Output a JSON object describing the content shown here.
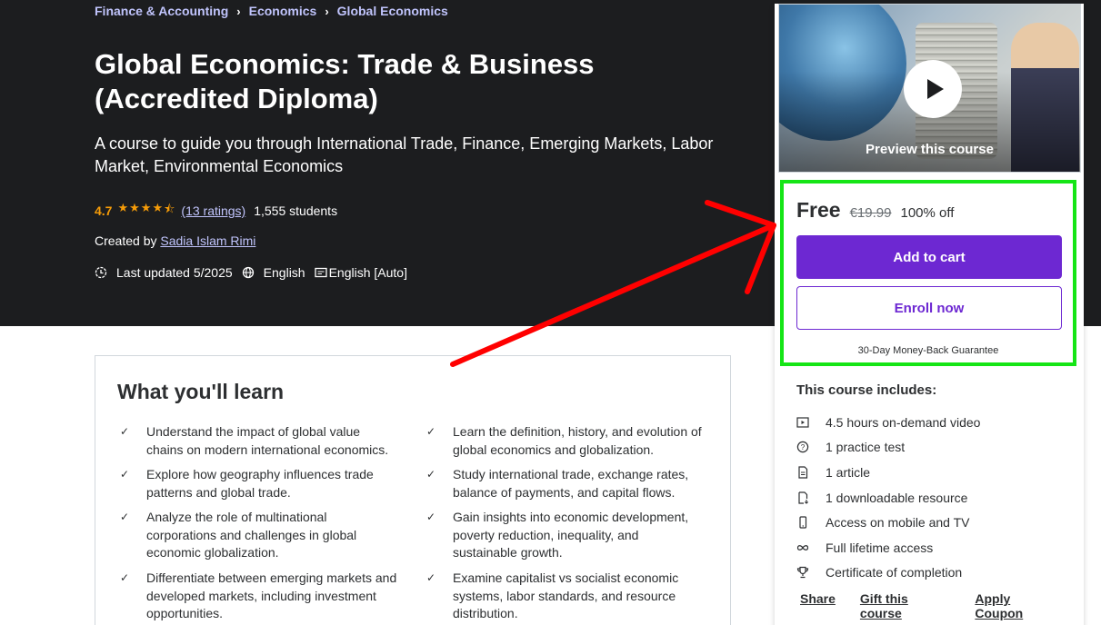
{
  "breadcrumb": [
    "Finance & Accounting",
    "Economics",
    "Global Economics"
  ],
  "course": {
    "title": "Global Economics: Trade & Business (Accredited Diploma)",
    "subtitle": "A course to guide you through International Trade, Finance, Emerging Markets, Labor Market, Environmental Economics",
    "rating": "4.7",
    "rating_stars": 4.7,
    "ratings_count": "(13 ratings)",
    "students": "1,555 students",
    "created_by_label": "Created by",
    "author": "Sadia Islam Rimi",
    "last_updated": "Last updated 5/2025",
    "language": "English",
    "captions": "English [Auto]"
  },
  "learn": {
    "heading": "What you'll learn",
    "left": [
      "Understand the impact of global value chains on modern international economics.",
      "Explore how geography influences trade patterns and global trade.",
      "Analyze the role of multinational corporations and challenges in global economic globalization.",
      "Differentiate between emerging markets and developed markets, including investment opportunities."
    ],
    "right": [
      "Learn the definition, history, and evolution of global economics and globalization.",
      "Study international trade, exchange rates, balance of payments, and capital flows.",
      "Gain insights into economic development, poverty reduction, inequality, and sustainable growth.",
      "Examine capitalist vs socialist economic systems, labor standards, and resource distribution."
    ]
  },
  "sidebar": {
    "preview_label": "Preview this course",
    "price": "Free",
    "original_price": "€19.99",
    "discount": "100% off",
    "add_to_cart": "Add to cart",
    "enroll_now": "Enroll now",
    "guarantee": "30-Day Money-Back Guarantee",
    "includes_title": "This course includes:",
    "includes": [
      {
        "icon": "video-icon",
        "label": "4.5 hours on-demand video"
      },
      {
        "icon": "question-icon",
        "label": "1 practice test"
      },
      {
        "icon": "article-icon",
        "label": "1 article"
      },
      {
        "icon": "download-file-icon",
        "label": "1 downloadable resource"
      },
      {
        "icon": "mobile-icon",
        "label": "Access on mobile and TV"
      },
      {
        "icon": "infinity-icon",
        "label": "Full lifetime access"
      },
      {
        "icon": "trophy-icon",
        "label": "Certificate of completion"
      }
    ],
    "links": [
      "Share",
      "Gift this course",
      "Apply Coupon"
    ]
  },
  "colors": {
    "header_bg": "#1c1d1f",
    "link_purple_light": "#c0c4fc",
    "star_orange": "#f69c08",
    "primary_purple": "#6d28d2",
    "highlight_green": "#15e516",
    "annotation_red": "#ff0000"
  }
}
